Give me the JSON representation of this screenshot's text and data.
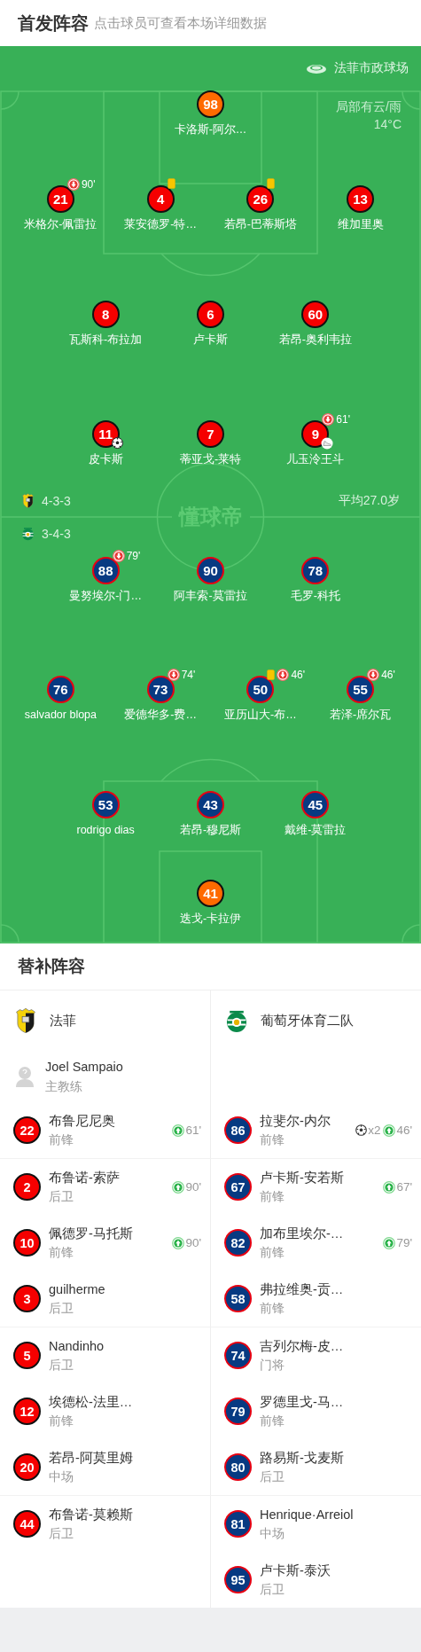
{
  "header": {
    "title": "首发阵容",
    "hint": "点击球员可查看本场详细数据"
  },
  "pitch": {
    "stadium": "法菲市政球场",
    "weather": "局部有云/雨",
    "temperature": "14°C",
    "center_logo": "懂球帝",
    "home": {
      "formation": "4-3-3",
      "average_age": "平均27.0岁",
      "lines": [
        [
          {
            "number": "98",
            "name": "卡洛斯-阿尔…",
            "goalkeeper": true
          }
        ],
        [
          {
            "number": "21",
            "name": "米格尔-佩雷拉",
            "goalkeeper": false,
            "events": [
              {
                "kind": "sub_off",
                "minute": "90'"
              }
            ]
          },
          {
            "number": "4",
            "name": "莱安德罗-特…",
            "goalkeeper": false,
            "events": [
              {
                "kind": "yellow_card"
              }
            ]
          },
          {
            "number": "26",
            "name": "若昂-巴蒂斯塔",
            "goalkeeper": false,
            "events": [
              {
                "kind": "yellow_card"
              }
            ]
          },
          {
            "number": "13",
            "name": "维加里奥",
            "goalkeeper": false
          }
        ],
        [
          {
            "number": "8",
            "name": "瓦斯科-布拉加",
            "goalkeeper": false
          },
          {
            "number": "6",
            "name": "卢卡斯",
            "goalkeeper": false
          },
          {
            "number": "60",
            "name": "若昂-奥利韦拉",
            "goalkeeper": false
          }
        ],
        [
          {
            "number": "11",
            "name": "皮卡斯",
            "goalkeeper": false,
            "events": [
              {
                "kind": "goal"
              }
            ]
          },
          {
            "number": "7",
            "name": "蒂亚戈-莱特",
            "goalkeeper": false
          },
          {
            "number": "9",
            "name": "儿玉泠王斗",
            "goalkeeper": false,
            "events": [
              {
                "kind": "sub_off",
                "minute": "61'"
              },
              {
                "kind": "assist"
              }
            ]
          }
        ]
      ]
    },
    "away": {
      "formation": "3-4-3",
      "lines": [
        [
          {
            "number": "88",
            "name": "曼努埃尔-门…",
            "goalkeeper": false,
            "events": [
              {
                "kind": "sub_off",
                "minute": "79'"
              }
            ]
          },
          {
            "number": "90",
            "name": "阿丰索-莫雷拉",
            "goalkeeper": false
          },
          {
            "number": "78",
            "name": "毛罗-科托",
            "goalkeeper": false
          }
        ],
        [
          {
            "number": "76",
            "name": "salvador blopa",
            "goalkeeper": false
          },
          {
            "number": "73",
            "name": "爱德华多-费…",
            "goalkeeper": false,
            "events": [
              {
                "kind": "sub_off",
                "minute": "74'"
              }
            ]
          },
          {
            "number": "50",
            "name": "亚历山大-布…",
            "goalkeeper": false,
            "events": [
              {
                "kind": "yellow_card"
              },
              {
                "kind": "sub_off",
                "minute": "46'"
              }
            ]
          },
          {
            "number": "55",
            "name": "若泽-席尔瓦",
            "goalkeeper": false,
            "events": [
              {
                "kind": "sub_off",
                "minute": "46'"
              }
            ]
          }
        ],
        [
          {
            "number": "53",
            "name": "rodrigo dias",
            "goalkeeper": false
          },
          {
            "number": "43",
            "name": "若昂-穆尼斯",
            "goalkeeper": false
          },
          {
            "number": "45",
            "name": "戴维-莫雷拉",
            "goalkeeper": false
          }
        ],
        [
          {
            "number": "41",
            "name": "迭戈-卡拉伊",
            "goalkeeper": true
          }
        ]
      ]
    }
  },
  "substitutes": {
    "title": "替补阵容",
    "home": {
      "team": "法菲",
      "coach": {
        "name": "Joel Sampaio",
        "role": "主教练"
      }
    },
    "away": {
      "team": "葡萄牙体育二队"
    },
    "groups": [
      {
        "home": [
          {
            "number": "22",
            "name": "布鲁尼尼奥",
            "position": "前锋",
            "events": [
              {
                "kind": "sub_on",
                "minute": "61'"
              }
            ]
          }
        ],
        "away": [
          {
            "number": "86",
            "name": "拉斐尔-内尔",
            "position": "前锋",
            "events": [
              {
                "kind": "goal",
                "count": "x2"
              },
              {
                "kind": "sub_on",
                "minute": "46'"
              }
            ]
          }
        ]
      },
      {
        "home": [
          {
            "number": "2",
            "name": "布鲁诺-索萨",
            "position": "后卫",
            "events": [
              {
                "kind": "sub_on",
                "minute": "90'"
              }
            ]
          },
          {
            "number": "10",
            "name": "佩德罗-马托斯",
            "position": "前锋",
            "events": [
              {
                "kind": "sub_on",
                "minute": "90'"
              }
            ]
          },
          {
            "number": "3",
            "name": "guilherme",
            "position": "后卫"
          }
        ],
        "away": [
          {
            "number": "67",
            "name": "卢卡斯-安若斯",
            "position": "前锋",
            "events": [
              {
                "kind": "sub_on",
                "minute": "67'"
              }
            ]
          },
          {
            "number": "82",
            "name": "加布里埃尔-…",
            "position": "前锋",
            "events": [
              {
                "kind": "sub_on",
                "minute": "79'"
              }
            ]
          },
          {
            "number": "58",
            "name": "弗拉维奥-贡…",
            "position": "前锋"
          }
        ]
      },
      {
        "home": [
          {
            "number": "5",
            "name": "Nandinho",
            "position": "后卫"
          },
          {
            "number": "12",
            "name": "埃德松-法里…",
            "position": "前锋"
          },
          {
            "number": "20",
            "name": "若昂-阿莫里姆",
            "position": "中场"
          }
        ],
        "away": [
          {
            "number": "74",
            "name": "吉列尔梅-皮…",
            "position": "门将"
          },
          {
            "number": "79",
            "name": "罗德里戈-马…",
            "position": "前锋"
          },
          {
            "number": "80",
            "name": "路易斯-戈麦斯",
            "position": "后卫"
          }
        ]
      },
      {
        "home": [
          {
            "number": "44",
            "name": "布鲁诺-莫赖斯",
            "position": "后卫"
          }
        ],
        "away": [
          {
            "number": "81",
            "name": "Henrique·Arreiol",
            "position": "中场"
          },
          {
            "number": "95",
            "name": "卢卡斯-泰沃",
            "position": "后卫"
          }
        ]
      }
    ]
  }
}
